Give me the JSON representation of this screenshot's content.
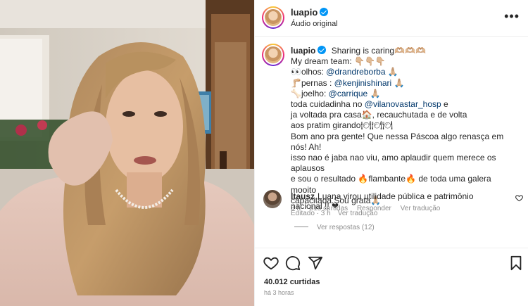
{
  "post": {
    "username": "luapio",
    "audio": "Áudio original",
    "more": "•••"
  },
  "caption": {
    "username": "luapio",
    "line1": "Sharing is caring🫶🏼🫶🏼🫶🏼",
    "line2": "My dream team: 👇🏼👇🏼👇🏼",
    "line3_prefix": "👀olhos: ",
    "line3_mention": "@drandreborba",
    "line3_suffix": " 🙏🏼",
    "line4_prefix": "🦵🏼pernas : ",
    "line4_mention": "@kenjinishinari",
    "line4_suffix": " 🙏🏼",
    "line5_prefix": "🦴joelho: ",
    "line5_mention": "@carrique",
    "line5_suffix": " 🙏🏼",
    "line6_prefix": "toda cuidadinha no ",
    "line6_mention": "@vilanovastar_hosp",
    "line6_suffix": " e",
    "line7": "ja voltada pra casa🏠, recauchutada e de volta",
    "line8": "aos pratim girando🍽🍽🍽",
    "line9": "Bom ano pra gente! Que nessa Páscoa algo renasça em nós! Ah!",
    "line10": "isso nao é jaba nao viu, amo aplaudir quem merece os aplausos",
    "line11": "e sou o resultado 🔥flambante🔥 de toda uma galera mooito",
    "line12": "capacitada.Sou grata🙏🏼",
    "edited": "Editado · 3 h",
    "translate": "Ver tradução"
  },
  "comment": {
    "username": "ltausz",
    "text": "Luana virou utilidade pública e patrimônio nacional !! ❤",
    "time": "3 h",
    "likes": "815 curtidas",
    "reply": "Responder",
    "translate": "Ver tradução",
    "view_replies": "Ver respostas (12)"
  },
  "footer": {
    "likes": "40.012 curtidas",
    "time": "há 3 horas"
  },
  "icons": {
    "heart": "heart-icon",
    "comment": "comment-icon",
    "share": "share-icon",
    "save": "bookmark-icon"
  },
  "colors": {
    "verified": "#0095f6",
    "mention": "#00376b",
    "secondary_text": "#8e8e8e"
  }
}
